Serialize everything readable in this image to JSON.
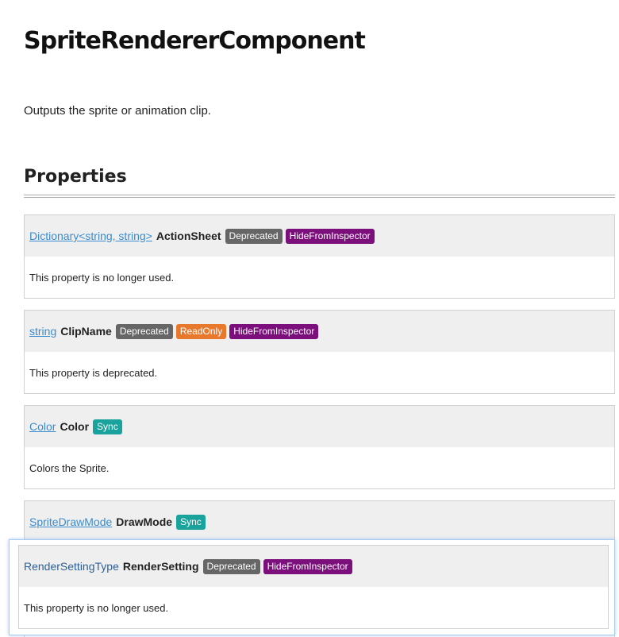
{
  "page": {
    "title": "SpriteRendererComponent",
    "description": "Outputs the sprite or animation clip."
  },
  "sections": {
    "properties_heading": "Properties"
  },
  "properties": [
    {
      "type": "Dictionary<string, string>",
      "name": "ActionSheet",
      "badges": [
        "Deprecated",
        "HideFromInspector"
      ],
      "description": "This property is no longer used."
    },
    {
      "type": "string",
      "name": "ClipName",
      "badges": [
        "Deprecated",
        "ReadOnly",
        "HideFromInspector"
      ],
      "description": "This property is deprecated."
    },
    {
      "type": "Color",
      "name": "Color",
      "badges": [
        "Sync"
      ],
      "description": "Colors the Sprite."
    },
    {
      "type": "SpriteDrawMode",
      "name": "DrawMode",
      "badges": [
        "Sync"
      ]
    }
  ],
  "highlighted_property": {
    "type": "RenderSettingType",
    "name": "RenderSetting",
    "badges": [
      "Deprecated",
      "HideFromInspector"
    ],
    "description": "This property is no longer used."
  },
  "colors": {
    "link": "#3b8bd0",
    "deprecated_badge": "#666666",
    "hide_badge": "#7b0f7b",
    "readonly_badge": "#e8792c",
    "sync_badge": "#1aa39c",
    "header_bg": "#efefef"
  }
}
